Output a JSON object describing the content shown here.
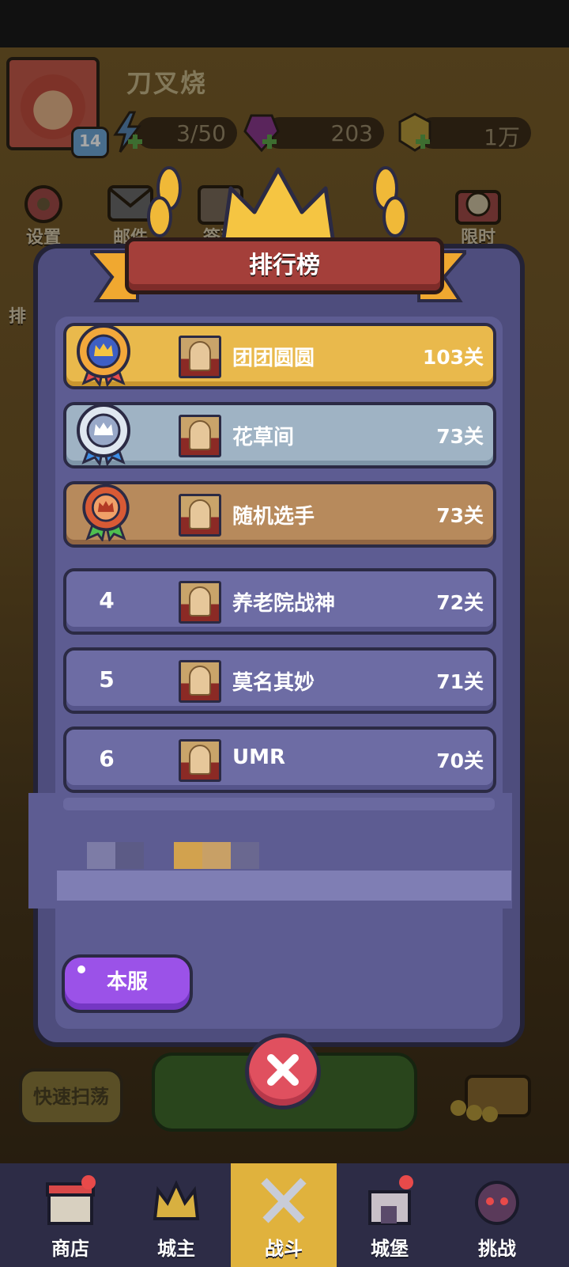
{
  "player": {
    "name": "刀叉烧",
    "level": "14"
  },
  "resources": {
    "energy": "3/50",
    "gems": "203",
    "coins": "1万"
  },
  "side_menu": {
    "settings": "设置",
    "mail": "邮件",
    "signin": "签到",
    "limited": "限时",
    "rank_partial": "排"
  },
  "modal": {
    "title": "排行榜"
  },
  "leaderboard": [
    {
      "rank": "1",
      "name": "团团圆圆",
      "score": "103关",
      "tier": "gold"
    },
    {
      "rank": "2",
      "name": "花草间",
      "score": "73关",
      "tier": "silver"
    },
    {
      "rank": "3",
      "name": "随机选手",
      "score": "73关",
      "tier": "bronze"
    },
    {
      "rank": "4",
      "name": "养老院战神",
      "score": "72关",
      "tier": "plain"
    },
    {
      "rank": "5",
      "name": "莫名其妙",
      "score": "71关",
      "tier": "plain"
    },
    {
      "rank": "6",
      "name": "UMR",
      "score": "70关",
      "tier": "plain"
    }
  ],
  "server_button": "本服",
  "behind": {
    "quick_sweep": "快速扫荡"
  },
  "bottom_nav": [
    {
      "label": "商店"
    },
    {
      "label": "城主"
    },
    {
      "label": "战斗"
    },
    {
      "label": "城堡"
    },
    {
      "label": "挑战"
    }
  ],
  "colors": {
    "modal_bg": "#4e4d7d",
    "gold_row": "#e9b94c",
    "silver_row": "#9fb3c4",
    "bronze_row": "#b78a5c",
    "plain_row": "#6d6ca4",
    "title_banner": "#a43f3a",
    "server_button": "#9b52e8",
    "close_button": "#e0505f",
    "nav_active": "#e0b23d"
  }
}
